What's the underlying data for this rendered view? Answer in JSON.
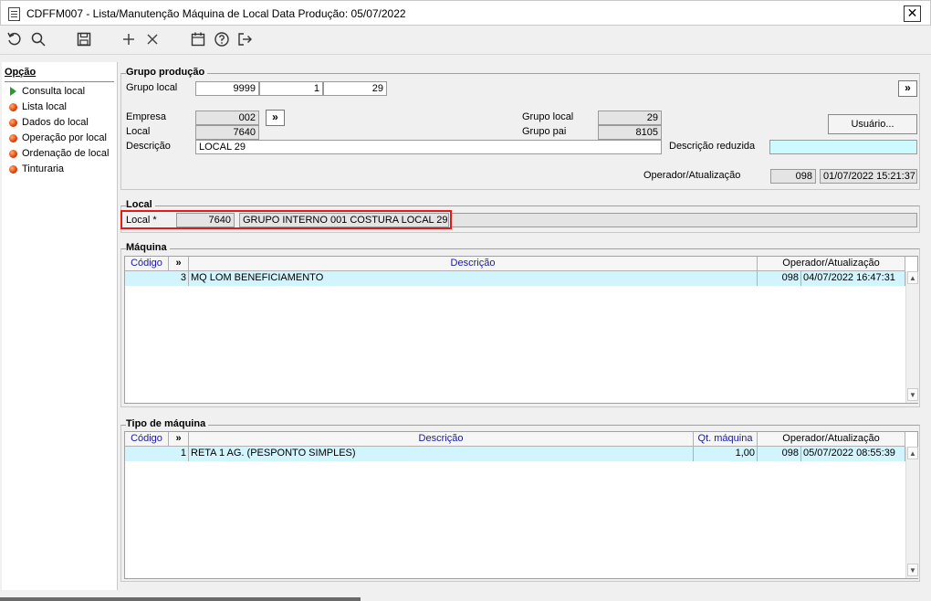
{
  "window": {
    "title": "CDFFM007 - Lista/Manutenção Máquina de Local Data Produção: 05/07/2022",
    "close": "✕"
  },
  "toolbar": {
    "items": [
      {
        "icon": "refresh-icon"
      },
      {
        "icon": "search-icon"
      },
      {
        "icon": "save-icon"
      },
      {
        "icon": "add-icon"
      },
      {
        "icon": "delete-icon"
      },
      {
        "icon": "calendar-icon"
      },
      {
        "icon": "help-icon"
      },
      {
        "icon": "exit-icon"
      }
    ]
  },
  "sidebar": {
    "heading": "Opção",
    "items": [
      {
        "label": "Consulta local",
        "marker": "arrow"
      },
      {
        "label": "Lista local",
        "marker": "dot"
      },
      {
        "label": "Dados do local",
        "marker": "dot"
      },
      {
        "label": "Operação por local",
        "marker": "dot"
      },
      {
        "label": "Ordenação de local",
        "marker": "dot"
      },
      {
        "label": "Tinturaria",
        "marker": "dot"
      }
    ]
  },
  "grupo_producao": {
    "title": "Grupo produção",
    "grupo_local_label": "Grupo local",
    "grupo_local_1": "9999",
    "grupo_local_2": "1",
    "grupo_local_3": "29",
    "next_button": "»",
    "empresa_label": "Empresa",
    "empresa": "002",
    "empresa_button": "»",
    "local_label": "Local",
    "local": "7640",
    "descricao_label": "Descrição",
    "descricao": "LOCAL 29",
    "grupo_local_right_label": "Grupo local",
    "grupo_local_right": "29",
    "grupo_pai_label": "Grupo pai",
    "grupo_pai": "8105",
    "usuario_button": "Usuário...",
    "descricao_reduzida_label": "Descrição reduzida",
    "descricao_reduzida": "",
    "operador_label": "Operador/Atualização",
    "operador": "098",
    "atualizacao": "01/07/2022 15:21:37"
  },
  "local": {
    "title": "Local",
    "label": "Local *",
    "code": "7640",
    "description": "GRUPO INTERNO 001 COSTURA LOCAL 29"
  },
  "maquina": {
    "title": "Máquina",
    "columns": {
      "codigo": "Código",
      "expand": "»",
      "descricao": "Descrição",
      "operador": "Operador/Atualização"
    },
    "rows": [
      {
        "codigo": "3",
        "descricao": "MQ LOM BENEFICIAMENTO",
        "operador": "098",
        "atualizacao": "04/07/2022 16:47:31"
      }
    ]
  },
  "tipo_maquina": {
    "title": "Tipo de máquina",
    "columns": {
      "codigo": "Código",
      "expand": "»",
      "descricao": "Descrição",
      "qt": "Qt. máquina",
      "operador": "Operador/Atualização"
    },
    "rows": [
      {
        "codigo": "1",
        "descricao": "RETA 1 AG. (PESPONTO SIMPLES)",
        "qt": "1,00",
        "operador": "098",
        "atualizacao": "05/07/2022 08:55:39"
      }
    ]
  }
}
